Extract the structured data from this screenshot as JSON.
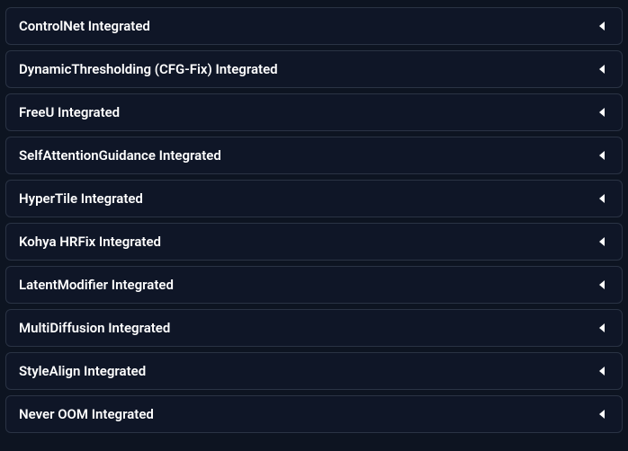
{
  "panels": [
    {
      "label": "ControlNet Integrated"
    },
    {
      "label": "DynamicThresholding (CFG-Fix) Integrated"
    },
    {
      "label": "FreeU Integrated"
    },
    {
      "label": "SelfAttentionGuidance Integrated"
    },
    {
      "label": "HyperTile Integrated"
    },
    {
      "label": "Kohya HRFix Integrated"
    },
    {
      "label": "LatentModifier Integrated"
    },
    {
      "label": "MultiDiffusion Integrated"
    },
    {
      "label": "StyleAlign Integrated"
    },
    {
      "label": "Never OOM Integrated"
    }
  ]
}
